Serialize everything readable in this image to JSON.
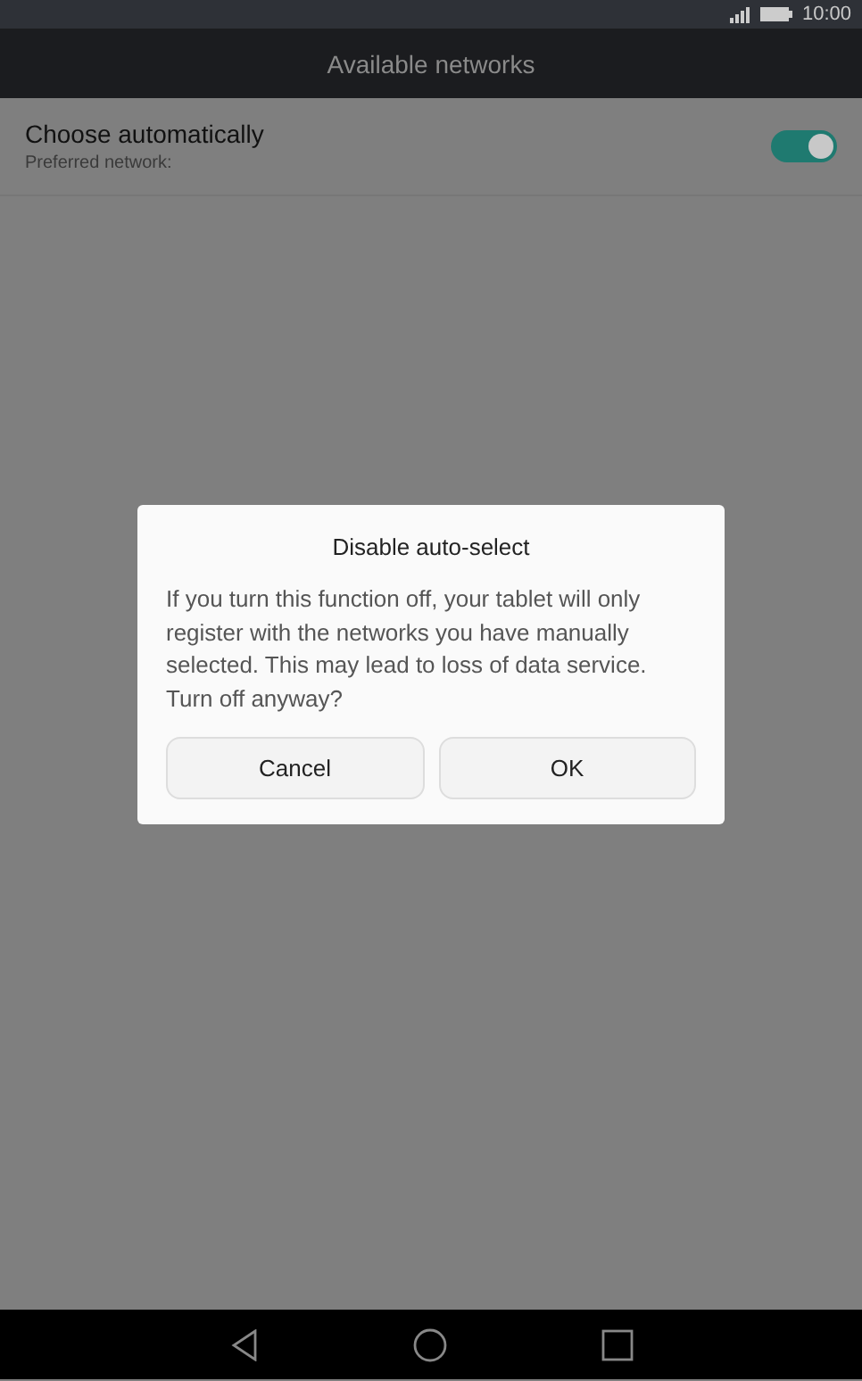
{
  "status_bar": {
    "time": "10:00"
  },
  "title_bar": {
    "title": "Available networks"
  },
  "setting": {
    "label": "Choose automatically",
    "sublabel": "Preferred network:",
    "on": true
  },
  "dialog": {
    "title": "Disable auto-select",
    "message": "If you turn this function off, your tablet will only register with the networks you have manually selected. This may lead to loss of data service. Turn off anyway?",
    "buttons": [
      "Cancel",
      "OK"
    ]
  }
}
